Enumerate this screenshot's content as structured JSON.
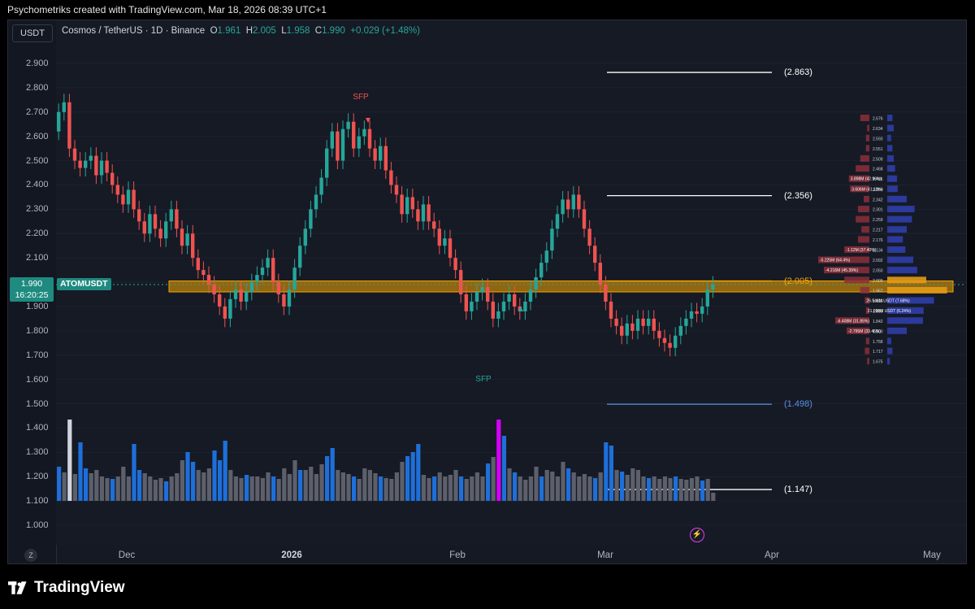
{
  "header": {
    "caption": "Psychometriks created with TradingView.com, Mar 18, 2026 08:39 UTC+1"
  },
  "toolbar": {
    "currency_button": "USDT",
    "z_button": "Z"
  },
  "legend": {
    "title": "Cosmos / TetherUS · 1D · Binance",
    "o_label": "O",
    "o_value": "1.961",
    "h_label": "H",
    "h_value": "2.005",
    "l_label": "L",
    "l_value": "1.958",
    "c_label": "C",
    "c_value": "1.990",
    "change": "+0.029 (+1.48%)"
  },
  "price_tag": {
    "price": "1.990",
    "countdown": "16:20:25",
    "symbol": "ATOMUSDT"
  },
  "levels": [
    {
      "label": "(2.863)",
      "value": 2.863,
      "color": "#ffffff"
    },
    {
      "label": "(2.356)",
      "value": 2.356,
      "color": "#ffffff"
    },
    {
      "label": "(2.005)",
      "value": 2.005,
      "color": "#f7a600"
    },
    {
      "label": "(1.498)",
      "value": 1.498,
      "color": "#5b8ee6"
    },
    {
      "label": "(1.147)",
      "value": 1.147,
      "color": "#ffffff"
    }
  ],
  "annotations": {
    "sfp_top": "SFP",
    "sfp_bottom": "SFP"
  },
  "colors": {
    "up": "#26a69a",
    "down": "#ef5350",
    "zone": "#f7a600",
    "vol_blue": "#1e6fd9",
    "vol_gray": "#5d606b",
    "vol_magenta": "#d500f9"
  },
  "footer": {
    "brand": "TradingView"
  },
  "chart_data": {
    "type": "candlestick",
    "symbol": "ATOMUSDT",
    "ylim": [
      0.95,
      3.0
    ],
    "yticks": [
      "2.900",
      "2.800",
      "2.700",
      "2.600",
      "2.500",
      "2.400",
      "2.300",
      "2.200",
      "2.100",
      "2.000",
      "1.900",
      "1.800",
      "1.700",
      "1.600",
      "1.500",
      "1.400",
      "1.300",
      "1.200",
      "1.100",
      "1.000"
    ],
    "xticks": [
      "Dec",
      "2026",
      "Feb",
      "Mar",
      "Apr",
      "May"
    ],
    "closes": [
      2.7,
      2.74,
      2.55,
      2.5,
      2.47,
      2.5,
      2.52,
      2.44,
      2.5,
      2.45,
      2.4,
      2.36,
      2.32,
      2.38,
      2.3,
      2.25,
      2.2,
      2.28,
      2.22,
      2.18,
      2.25,
      2.3,
      2.22,
      2.15,
      2.2,
      2.1,
      2.05,
      2.03,
      1.99,
      1.95,
      1.9,
      1.85,
      1.93,
      1.97,
      1.92,
      1.96,
      2.0,
      2.03,
      2.06,
      2.1,
      2.0,
      1.95,
      1.9,
      1.97,
      2.06,
      2.15,
      2.22,
      2.3,
      2.36,
      2.43,
      2.55,
      2.62,
      2.5,
      2.63,
      2.66,
      2.55,
      2.6,
      2.63,
      2.55,
      2.5,
      2.56,
      2.46,
      2.4,
      2.36,
      2.28,
      2.35,
      2.3,
      2.25,
      2.32,
      2.25,
      2.22,
      2.15,
      2.18,
      2.1,
      2.05,
      1.95,
      1.88,
      1.92,
      1.96,
      1.98,
      1.92,
      1.85,
      1.88,
      1.92,
      1.95,
      1.9,
      1.88,
      1.92,
      1.97,
      2.02,
      2.08,
      2.13,
      2.22,
      2.28,
      2.34,
      2.3,
      2.36,
      2.3,
      2.22,
      2.15,
      2.08,
      1.99,
      1.92,
      1.85,
      1.82,
      1.78,
      1.83,
      1.8,
      1.85,
      1.82,
      1.85,
      1.8,
      1.77,
      1.75,
      1.73,
      1.78,
      1.82,
      1.85,
      1.88,
      1.87,
      1.9,
      1.97,
      1.99
    ],
    "volume_scale_ticks": [
      "1.400",
      "1.300",
      "1.200",
      "1.100",
      "1.000"
    ],
    "volumes": [
      0.42,
      0.35,
      1.0,
      0.33,
      0.72,
      0.4,
      0.34,
      0.38,
      0.3,
      0.28,
      0.27,
      0.3,
      0.42,
      0.3,
      0.7,
      0.38,
      0.34,
      0.3,
      0.26,
      0.28,
      0.24,
      0.3,
      0.34,
      0.5,
      0.6,
      0.48,
      0.38,
      0.35,
      0.4,
      0.62,
      0.5,
      0.74,
      0.38,
      0.3,
      0.28,
      0.32,
      0.3,
      0.3,
      0.28,
      0.35,
      0.3,
      0.27,
      0.4,
      0.33,
      0.5,
      0.38,
      0.38,
      0.42,
      0.33,
      0.45,
      0.55,
      0.65,
      0.38,
      0.35,
      0.33,
      0.3,
      0.27,
      0.4,
      0.38,
      0.34,
      0.3,
      0.28,
      0.27,
      0.35,
      0.48,
      0.55,
      0.6,
      0.7,
      0.32,
      0.28,
      0.3,
      0.35,
      0.3,
      0.32,
      0.38,
      0.3,
      0.27,
      0.3,
      0.35,
      0.3,
      0.46,
      0.54,
      1.0,
      0.8,
      0.4,
      0.35,
      0.3,
      0.26,
      0.3,
      0.42,
      0.3,
      0.38,
      0.36,
      0.3,
      0.48,
      0.4,
      0.35,
      0.3,
      0.33,
      0.3,
      0.28,
      0.35,
      0.72,
      0.68,
      0.38,
      0.36,
      0.32,
      0.4,
      0.38,
      0.3,
      0.28,
      0.3,
      0.27,
      0.3,
      0.28,
      0.3,
      0.27,
      0.26,
      0.28,
      0.3,
      0.25,
      0.27,
      0.1
    ],
    "volume_profile_prices": [
      "2.676",
      "2.634",
      "2.593",
      "2.551",
      "2.509",
      "2.468",
      "2.426",
      "2.384",
      "2.342",
      "2.301",
      "2.259",
      "2.217",
      "2.176",
      "2.134",
      "2.092",
      "2.050",
      "2.009",
      "1.967",
      "1.925",
      "1.883",
      "1.842",
      "1.800",
      "1.758",
      "1.717",
      "1.675"
    ],
    "volume_profile_labels": [
      "",
      "",
      "",
      "",
      "",
      "",
      "3.898M (42.96%)",
      "3.606M (41.10%)",
      "",
      "",
      "",
      "",
      "",
      "-1.12M (37.40%)",
      "-5.225M (64.4%)",
      "-4.216M (45.39%)",
      "",
      "",
      "26.546M USDT (7.68%)",
      "21.098M USDT (6.24%)",
      "-6.408M (31.85%)",
      "-2.795M (33.46%)",
      "",
      "",
      ""
    ],
    "volume_profile_sell": [
      0.08,
      0.02,
      0.03,
      0.03,
      0.08,
      0.12,
      0.18,
      0.17,
      0.05,
      0.1,
      0.12,
      0.07,
      0.1,
      0.22,
      0.45,
      0.4,
      0.22,
      0.08,
      0.04,
      0.03,
      0.3,
      0.2,
      0.03,
      0.04,
      0.02
    ],
    "volume_profile_buy": [
      0.08,
      0.1,
      0.06,
      0.08,
      0.1,
      0.12,
      0.15,
      0.16,
      0.3,
      0.42,
      0.38,
      0.3,
      0.24,
      0.28,
      0.4,
      0.46,
      0.6,
      0.92,
      0.72,
      0.56,
      0.55,
      0.3,
      0.06,
      0.08,
      0.04
    ],
    "volume_profile_poc": "17.457M USDT (10.6%)"
  }
}
